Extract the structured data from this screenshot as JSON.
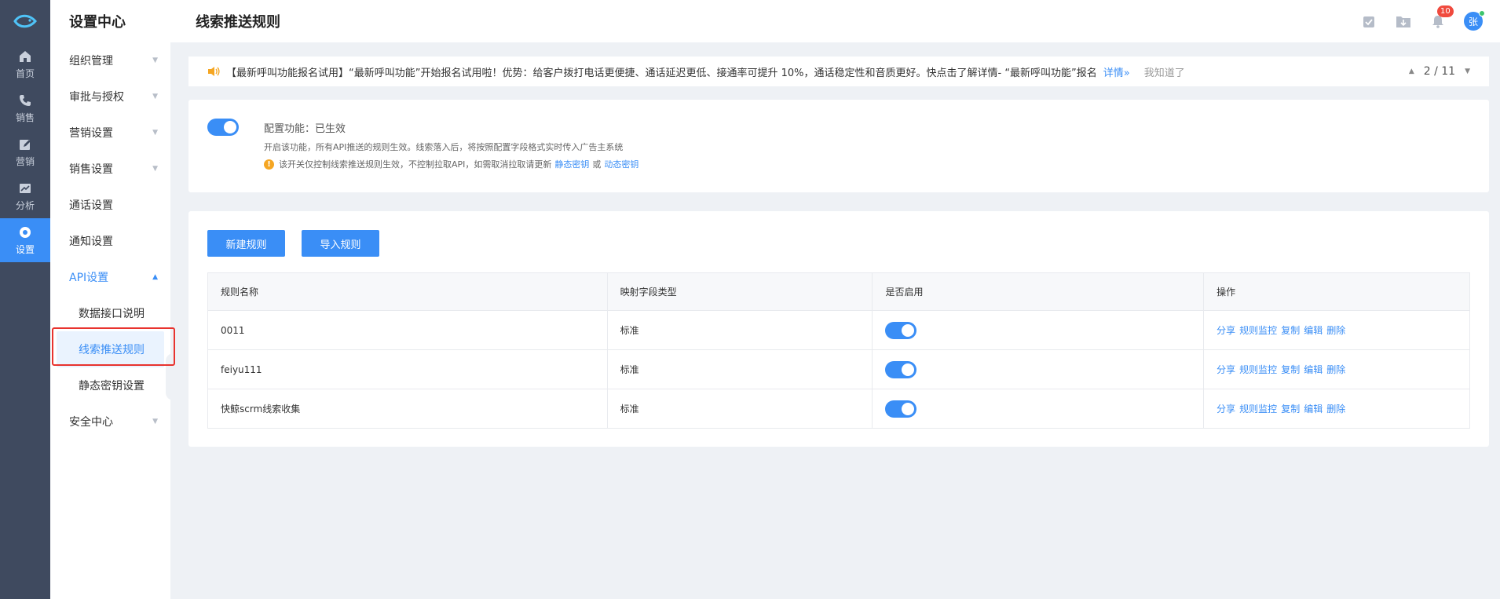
{
  "rail": {
    "items": [
      {
        "label": "首页",
        "icon": "home-icon"
      },
      {
        "label": "销售",
        "icon": "phone-icon"
      },
      {
        "label": "营销",
        "icon": "edit-icon"
      },
      {
        "label": "分析",
        "icon": "chart-icon"
      },
      {
        "label": "设置",
        "icon": "gear-icon"
      }
    ]
  },
  "menu": {
    "title": "设置中心",
    "items": [
      {
        "label": "组织管理"
      },
      {
        "label": "审批与授权"
      },
      {
        "label": "营销设置"
      },
      {
        "label": "销售设置"
      },
      {
        "label": "通话设置"
      },
      {
        "label": "通知设置"
      },
      {
        "label": "API设置"
      },
      {
        "label": "安全中心"
      }
    ],
    "api_sub": [
      {
        "label": "数据接口说明"
      },
      {
        "label": "线索推送规则"
      },
      {
        "label": "静态密钥设置"
      }
    ]
  },
  "header": {
    "title": "线索推送规则",
    "notification_count": "10",
    "avatar_text": "张"
  },
  "notice": {
    "text": "【最新呼叫功能报名试用】“最新呼叫功能”开始报名试用啦！优势：给客户拨打电话更便捷、通话延迟更低、接通率可提升 10%，通话稳定性和音质更好。快点击了解详情- “最新呼叫功能”报名",
    "detail_link": "详情»",
    "dismiss": "我知道了",
    "pager": "2 / 11"
  },
  "config": {
    "enabled": true,
    "title": "配置功能：已生效",
    "desc": "开启该功能，所有API推送的规则生效。线索落入后，将按照配置字段格式实时传入广告主系统",
    "warn_text": "该开关仅控制线索推送规则生效，不控制拉取API，如需取消拉取请更新",
    "warn_link1": "静态密钥",
    "warn_or": "或",
    "warn_link2": "动态密钥"
  },
  "rules": {
    "new_button": "新建规则",
    "import_button": "导入规则",
    "columns": [
      "规则名称",
      "映射字段类型",
      "是否启用",
      "操作"
    ],
    "rows": [
      {
        "name": "0011",
        "type": "标准",
        "enabled": true
      },
      {
        "name": "feiyu111",
        "type": "标准",
        "enabled": true
      },
      {
        "name": "快鲸scrm线索收集",
        "type": "标准",
        "enabled": true
      }
    ],
    "actions": [
      "分享",
      "规则监控",
      "复制",
      "编辑",
      "删除"
    ]
  },
  "colors": {
    "accent": "#3a8ef6",
    "rail_bg": "#3f4a5f",
    "highlight": "#e8332e"
  }
}
